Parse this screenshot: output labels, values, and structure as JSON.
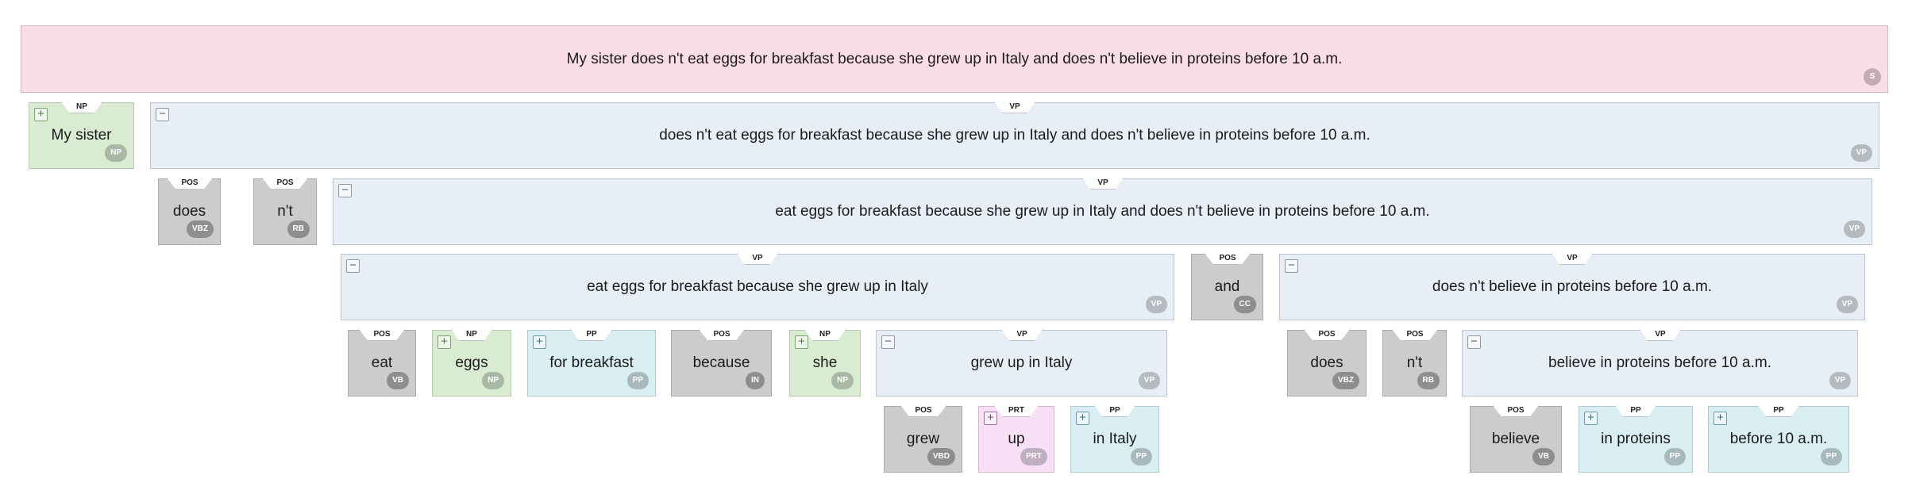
{
  "nodes": [
    {
      "id": "n0",
      "text": "My sister does n't eat eggs for breakfast because she grew up in Italy and does n't believe in proteins before 10 a.m.",
      "tag": "S",
      "type": "S",
      "toggle": ""
    },
    {
      "id": "n1",
      "text": "My sister",
      "tag": "NP",
      "type": "NP",
      "toggle": "+",
      "edge": "NP"
    },
    {
      "id": "n2",
      "text": "does n't eat eggs for breakfast because she grew up in Italy and does n't believe in proteins before 10 a.m.",
      "tag": "VP",
      "type": "VP",
      "toggle": "−",
      "edge": "VP"
    },
    {
      "id": "n3",
      "text": "does",
      "tag": "VBZ",
      "type": "POS",
      "toggle": "",
      "edge": "POS"
    },
    {
      "id": "n4",
      "text": "n't",
      "tag": "RB",
      "type": "POS",
      "toggle": "",
      "edge": "POS"
    },
    {
      "id": "n5",
      "text": "eat eggs for breakfast because she grew up in Italy and does n't believe in proteins before 10 a.m.",
      "tag": "VP",
      "type": "VP",
      "toggle": "−",
      "edge": "VP"
    },
    {
      "id": "n6",
      "text": "eat eggs for breakfast because she grew up in Italy",
      "tag": "VP",
      "type": "VP",
      "toggle": "−",
      "edge": "VP"
    },
    {
      "id": "n7",
      "text": "and",
      "tag": "CC",
      "type": "POS",
      "toggle": "",
      "edge": "POS"
    },
    {
      "id": "n8",
      "text": "does n't believe in proteins before 10 a.m.",
      "tag": "VP",
      "type": "VP",
      "toggle": "−",
      "edge": "VP"
    },
    {
      "id": "n9",
      "text": "eat",
      "tag": "VB",
      "type": "POS",
      "toggle": "",
      "edge": "POS"
    },
    {
      "id": "n10",
      "text": "eggs",
      "tag": "NP",
      "type": "NP",
      "toggle": "+",
      "edge": "NP"
    },
    {
      "id": "n11",
      "text": "for breakfast",
      "tag": "PP",
      "type": "PP",
      "toggle": "+",
      "edge": "PP"
    },
    {
      "id": "n12",
      "text": "because",
      "tag": "IN",
      "type": "POS",
      "toggle": "",
      "edge": "POS"
    },
    {
      "id": "n13",
      "text": "she",
      "tag": "NP",
      "type": "NP",
      "toggle": "+",
      "edge": "NP"
    },
    {
      "id": "n14",
      "text": "grew up in Italy",
      "tag": "VP",
      "type": "VP",
      "toggle": "−",
      "edge": "VP"
    },
    {
      "id": "n15",
      "text": "does",
      "tag": "VBZ",
      "type": "POS",
      "toggle": "",
      "edge": "POS"
    },
    {
      "id": "n16",
      "text": "n't",
      "tag": "RB",
      "type": "POS",
      "toggle": "",
      "edge": "POS"
    },
    {
      "id": "n17",
      "text": "believe in proteins before 10 a.m.",
      "tag": "VP",
      "type": "VP",
      "toggle": "−",
      "edge": "VP"
    },
    {
      "id": "n18",
      "text": "grew",
      "tag": "VBD",
      "type": "POS",
      "toggle": "",
      "edge": "POS"
    },
    {
      "id": "n19",
      "text": "up",
      "tag": "PRT",
      "type": "PRT",
      "toggle": "+",
      "edge": "PRT"
    },
    {
      "id": "n20",
      "text": "in Italy",
      "tag": "PP",
      "type": "PP",
      "toggle": "+",
      "edge": "PP"
    },
    {
      "id": "n21",
      "text": "believe",
      "tag": "VB",
      "type": "POS",
      "toggle": "",
      "edge": "POS"
    },
    {
      "id": "n22",
      "text": "in proteins",
      "tag": "PP",
      "type": "PP",
      "toggle": "+",
      "edge": "PP"
    },
    {
      "id": "n23",
      "text": "before 10 a.m.",
      "tag": "PP",
      "type": "PP",
      "toggle": "+",
      "edge": "PP"
    }
  ]
}
